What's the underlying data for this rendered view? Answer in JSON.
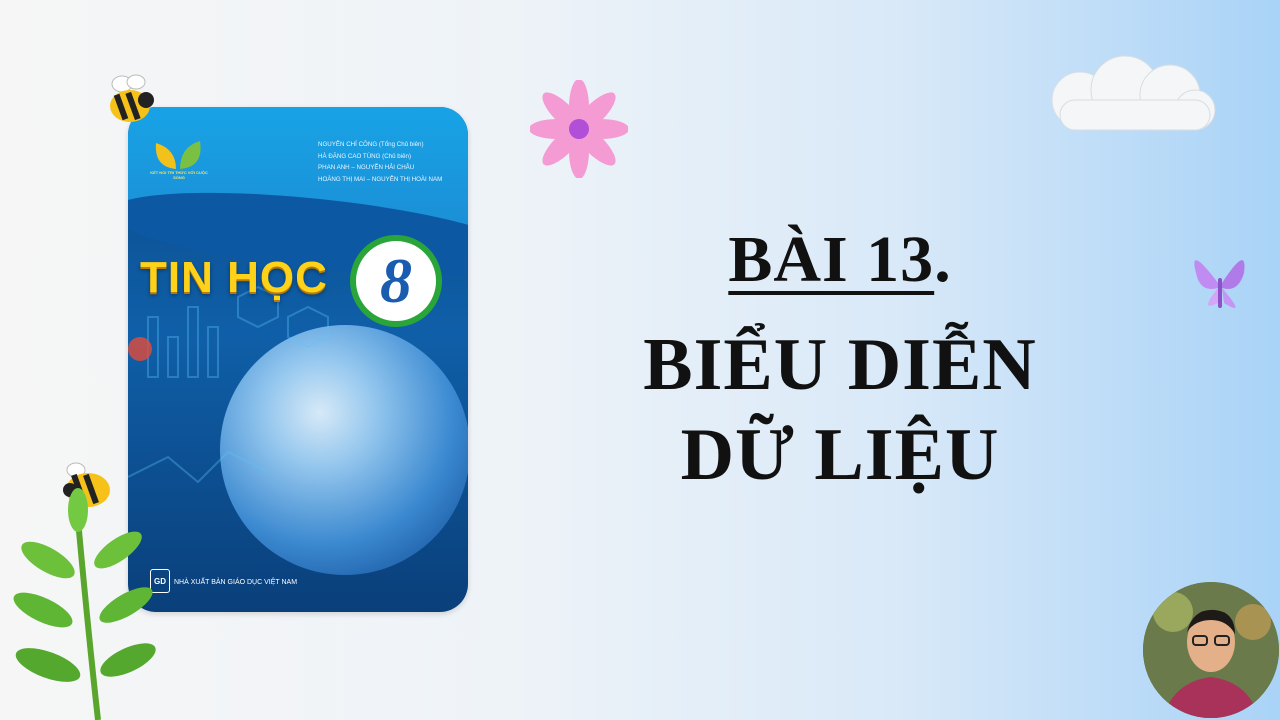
{
  "book": {
    "authors": [
      "NGUYỄN CHÍ CÔNG (Tổng Chủ biên)",
      "HÀ ĐẶNG CAO TÙNG (Chủ biên)",
      "PHAN ANH – NGUYỄN HẢI CHÂU",
      "HOÀNG THỊ MAI – NGUYỄN THỊ HOÀI NAM"
    ],
    "logo_caption": "KẾT NỐI TRI THỨC VỚI CUỘC SỐNG",
    "title": "TIN HỌC",
    "grade": "8",
    "publisher": "NHÀ XUẤT BẢN GIÁO DỤC VIỆT NAM",
    "publisher_logo": "GD"
  },
  "lesson": {
    "number_label": "BÀI 13",
    "number_suffix": ".",
    "title_line1": "BIỂU DIỄN",
    "title_line2": "DỮ LIỆU"
  },
  "decorations": {
    "icons": [
      "bee-icon",
      "flower-icon",
      "cloud-icon",
      "butterfly-icon",
      "leaf-branch-icon"
    ]
  },
  "colors": {
    "title_yellow": "#ffd21a",
    "grade_blue": "#1a5db0",
    "ring_green": "#2aa53a",
    "text_black": "#111111"
  }
}
